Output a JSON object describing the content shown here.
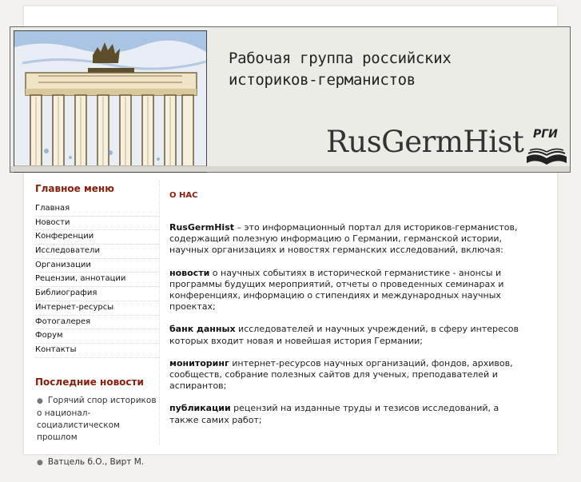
{
  "header": {
    "title_line1": "Рабочая группа российских",
    "title_line2": "историков-германистов",
    "logo_text": "RusGermHist",
    "logo_badge": "РГИ"
  },
  "sidebar": {
    "main_menu_title": "Главное меню",
    "items": [
      {
        "label": "Главная"
      },
      {
        "label": "Новости"
      },
      {
        "label": "Конференции"
      },
      {
        "label": "Исследователи"
      },
      {
        "label": "Организации"
      },
      {
        "label": "Рецензии, аннотации"
      },
      {
        "label": "Библиография"
      },
      {
        "label": "Интернет-ресурсы"
      },
      {
        "label": "Фотогалерея"
      },
      {
        "label": "Форум"
      },
      {
        "label": "Контакты"
      }
    ],
    "news_title": "Последние новости",
    "news": [
      {
        "text": "Горячий спор историков о национал-социалистическом прошлом"
      },
      {
        "text": "Ватцель б.О., Вирт М."
      }
    ]
  },
  "content": {
    "title": "О НАС",
    "paragraphs": [
      {
        "bold": "RusGermHist",
        "text": " – это информационный портал для историков-германистов, содержащий полезную информацию о Германии, германской истории, научных организациях и новостях германских исследований, включая:"
      },
      {
        "bold": "новости",
        "text": " о научных событиях в исторической германистике - анонсы и программы будущих мероприятий, отчеты о проведенных семинарах и конференциях, информацию о стипендиях и международных научных проектах;"
      },
      {
        "bold": "банк данных",
        "text": " исследователей и научных учреждений, в сферу интересов которых входит новая и новейшая история Германии;"
      },
      {
        "bold": "мониторинг",
        "text": " интернет-ресурсов научных организаций, фондов, архивов, сообществ, собрание полезных сайтов для ученых, преподавателей и аспирантов;"
      },
      {
        "bold": "публикации",
        "text": " рецензий на изданные труды и тезисов исследований, а также самих работ;"
      }
    ]
  }
}
